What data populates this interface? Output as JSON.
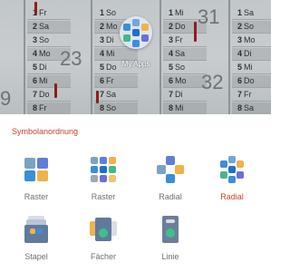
{
  "wallpaper": {
    "columns": [
      {
        "days": [
          [
            "1",
            "Fr"
          ],
          [
            "2",
            "Sa"
          ],
          [
            "3",
            "So"
          ],
          [
            "4",
            "Mo"
          ],
          [
            "5",
            "Di"
          ],
          [
            "6",
            "Mi"
          ],
          [
            "7",
            "Do"
          ],
          [
            "8",
            "Fr"
          ]
        ]
      },
      {
        "days": [
          [
            "1",
            "So"
          ],
          [
            "2",
            "Mo"
          ],
          [
            "3",
            "Di"
          ],
          [
            "4",
            "Mi"
          ],
          [
            "5",
            "Do"
          ],
          [
            "6",
            "Fr"
          ],
          [
            "7",
            "Sa"
          ],
          [
            "8",
            "So"
          ]
        ]
      },
      {
        "days": [
          [
            "1",
            "Mi"
          ],
          [
            "2",
            "Do"
          ],
          [
            "3",
            "Fr"
          ],
          [
            "4",
            "Sa"
          ],
          [
            "5",
            "So"
          ],
          [
            "6",
            "Mo"
          ],
          [
            "7",
            "Di"
          ],
          [
            "8",
            "Mi"
          ]
        ]
      },
      {
        "days": [
          [
            "1",
            "Sa"
          ],
          [
            "2",
            "So"
          ],
          [
            "3",
            "Mo"
          ],
          [
            "4",
            "Di"
          ],
          [
            "5",
            "Mi"
          ],
          [
            "6",
            "Do"
          ],
          [
            "7",
            "Fr"
          ],
          [
            "8",
            "Sa"
          ]
        ]
      }
    ],
    "week_numbers": {
      "w23": "23",
      "w31": "31",
      "w32": "32",
      "w9": "9"
    }
  },
  "folder": {
    "label": "My Apps"
  },
  "sheet": {
    "title": "Symbolanordnung",
    "options": [
      {
        "label": "Raster",
        "selected": false,
        "icon": "grid-4-icon"
      },
      {
        "label": "Raster",
        "selected": false,
        "icon": "grid-9-icon"
      },
      {
        "label": "Radial",
        "selected": false,
        "icon": "radial-icon"
      },
      {
        "label": "Radial",
        "selected": true,
        "icon": "radial-9-icon"
      },
      {
        "label": "Stapel",
        "selected": false,
        "icon": "stack-icon"
      },
      {
        "label": "Fächer",
        "selected": false,
        "icon": "fan-icon"
      },
      {
        "label": "Linie",
        "selected": false,
        "icon": "line-icon"
      }
    ]
  },
  "colors": {
    "accent": "#c8412f",
    "label": "#6f6f6f"
  }
}
